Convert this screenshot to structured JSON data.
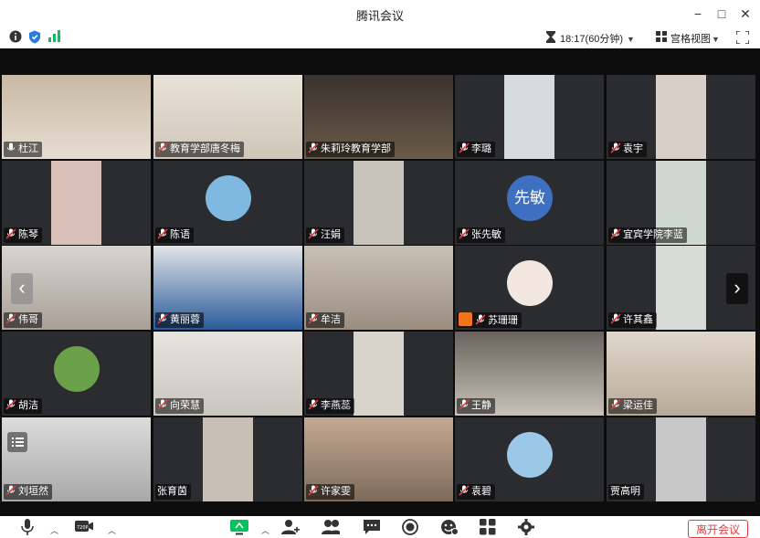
{
  "window": {
    "title": "腾讯会议",
    "controls": {
      "minimize": "−",
      "maximize": "□",
      "close": "✕"
    }
  },
  "infobar": {
    "timer": "18:17(60分钟)",
    "view_mode": "宫格视图",
    "icons": [
      "info-icon",
      "shield-icon",
      "signal-icon",
      "hourglass-icon",
      "grid-icon",
      "fullscreen-icon"
    ]
  },
  "participants": [
    {
      "name": "杜江",
      "mic": "on",
      "avatar_text": ""
    },
    {
      "name": "教育学部唐冬梅",
      "mic": "muted",
      "avatar_text": ""
    },
    {
      "name": "朱莉玲教育学部",
      "mic": "muted",
      "avatar_text": ""
    },
    {
      "name": "李璐",
      "mic": "muted",
      "avatar_text": ""
    },
    {
      "name": "袁宇",
      "mic": "muted",
      "avatar_text": ""
    },
    {
      "name": "陈琴",
      "mic": "muted",
      "avatar_text": ""
    },
    {
      "name": "陈语",
      "mic": "muted",
      "avatar_text": ""
    },
    {
      "name": "汪娟",
      "mic": "muted",
      "avatar_text": ""
    },
    {
      "name": "张先敏",
      "mic": "muted",
      "avatar_text": "先敏"
    },
    {
      "name": "宜宾学院李蓝",
      "mic": "muted",
      "avatar_text": ""
    },
    {
      "name": "伟哥",
      "mic": "muted",
      "avatar_text": ""
    },
    {
      "name": "黄丽蓉",
      "mic": "muted",
      "avatar_text": ""
    },
    {
      "name": "牟洁",
      "mic": "muted",
      "avatar_text": ""
    },
    {
      "name": "苏珊珊",
      "mic": "muted",
      "avatar_text": ""
    },
    {
      "name": "许其鑫",
      "mic": "muted",
      "avatar_text": ""
    },
    {
      "name": "胡洁",
      "mic": "muted",
      "avatar_text": ""
    },
    {
      "name": "向荣慧",
      "mic": "muted",
      "avatar_text": ""
    },
    {
      "name": "李燕蕊",
      "mic": "muted",
      "avatar_text": ""
    },
    {
      "name": "王静",
      "mic": "muted",
      "avatar_text": ""
    },
    {
      "name": "梁运佳",
      "mic": "muted",
      "avatar_text": ""
    },
    {
      "name": "刘垣然",
      "mic": "muted",
      "avatar_text": ""
    },
    {
      "name": "张育茵",
      "mic": "none",
      "avatar_text": ""
    },
    {
      "name": "许家雯",
      "mic": "muted",
      "avatar_text": ""
    },
    {
      "name": "袁碧",
      "mic": "muted",
      "avatar_text": ""
    },
    {
      "name": "贾高明",
      "mic": "none",
      "avatar_text": ""
    }
  ],
  "toolbar": {
    "leave_label": "离开会议",
    "icons": [
      "microphone-icon",
      "camera-icon",
      "screen-share-icon",
      "invite-icon",
      "participants-icon",
      "chat-icon",
      "record-icon",
      "reaction-icon",
      "apps-icon",
      "settings-icon"
    ]
  },
  "colors": {
    "brand_green": "#07c160",
    "accent_blue": "#3e6fc1",
    "leave_red": "#e03e3e",
    "stage_bg": "#0d0d0d"
  }
}
